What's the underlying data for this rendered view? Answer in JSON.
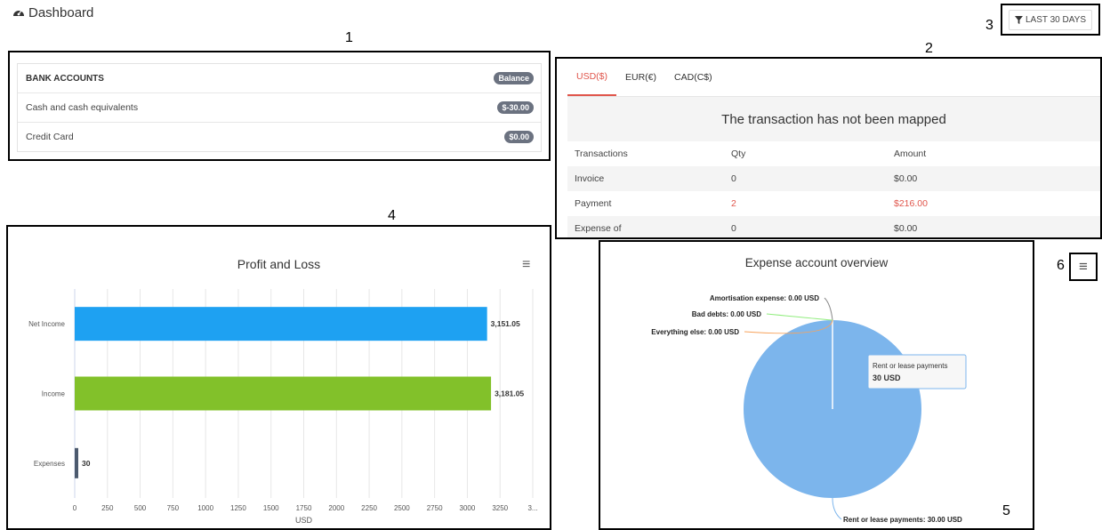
{
  "header": {
    "title": "Dashboard",
    "filter_label": "LAST 30 DAYS"
  },
  "callouts": [
    "1",
    "2",
    "3",
    "4",
    "5",
    "6"
  ],
  "bank_accounts": {
    "heading": "BANK ACCOUNTS",
    "heading_badge": "Balance",
    "rows": [
      {
        "name": "Cash and cash equivalents",
        "balance": "$-30.00"
      },
      {
        "name": "Credit Card",
        "balance": "$0.00"
      }
    ]
  },
  "transactions": {
    "tabs": [
      {
        "label": "USD($)",
        "active": true
      },
      {
        "label": "EUR(€)",
        "active": false
      },
      {
        "label": "CAD(C$)",
        "active": false
      }
    ],
    "message": "The transaction has not been mapped",
    "columns": [
      "Transactions",
      "Qty",
      "Amount"
    ],
    "rows": [
      {
        "name": "Invoice",
        "qty": "0",
        "amount": "$0.00",
        "highlight": false
      },
      {
        "name": "Payment",
        "qty": "2",
        "amount": "$216.00",
        "highlight": true
      },
      {
        "name": "Expense of",
        "qty": "0",
        "amount": "$0.00",
        "highlight": false
      }
    ]
  },
  "profit_loss": {
    "menu_icon": "hamburger-icon",
    "chart_data": {
      "type": "bar",
      "orientation": "horizontal",
      "title": "Profit and Loss",
      "xlabel": "USD",
      "ylabel": "",
      "categories": [
        "Net Income",
        "Income",
        "Expenses"
      ],
      "values": [
        3151.05,
        3181.05,
        30
      ],
      "data_labels": [
        "3,151.05",
        "3,181.05",
        "30"
      ],
      "colors": [
        "#1ea1f2",
        "#82c12a",
        "#4c5a6e"
      ],
      "xlim": [
        0,
        3500
      ],
      "x_ticks": [
        "0",
        "250",
        "500",
        "750",
        "1000",
        "1250",
        "1500",
        "1750",
        "2000",
        "2250",
        "2500",
        "2750",
        "3000",
        "3250",
        "3..."
      ],
      "grid": true
    }
  },
  "expense_overview": {
    "chart_data": {
      "type": "pie",
      "title": "Expense account overview",
      "slices": [
        {
          "label": "Rent or lease payments",
          "value": 30.0,
          "data_label": "Rent or lease payments: 30.00 USD",
          "color": "#7cb5ec"
        },
        {
          "label": "Amortisation expense",
          "value": 0.0,
          "data_label": "Amortisation expense: 0.00 USD",
          "color": "#888888"
        },
        {
          "label": "Bad debts",
          "value": 0.0,
          "data_label": "Bad debts: 0.00 USD",
          "color": "#90ed7d"
        },
        {
          "label": "Everything else",
          "value": 0.0,
          "data_label": "Everything else: 0.00 USD",
          "color": "#f7a35c"
        }
      ],
      "tooltip": {
        "title": "Rent or lease payments",
        "value": "30 USD"
      }
    }
  },
  "export_menu": {
    "icon": "hamburger-icon"
  }
}
